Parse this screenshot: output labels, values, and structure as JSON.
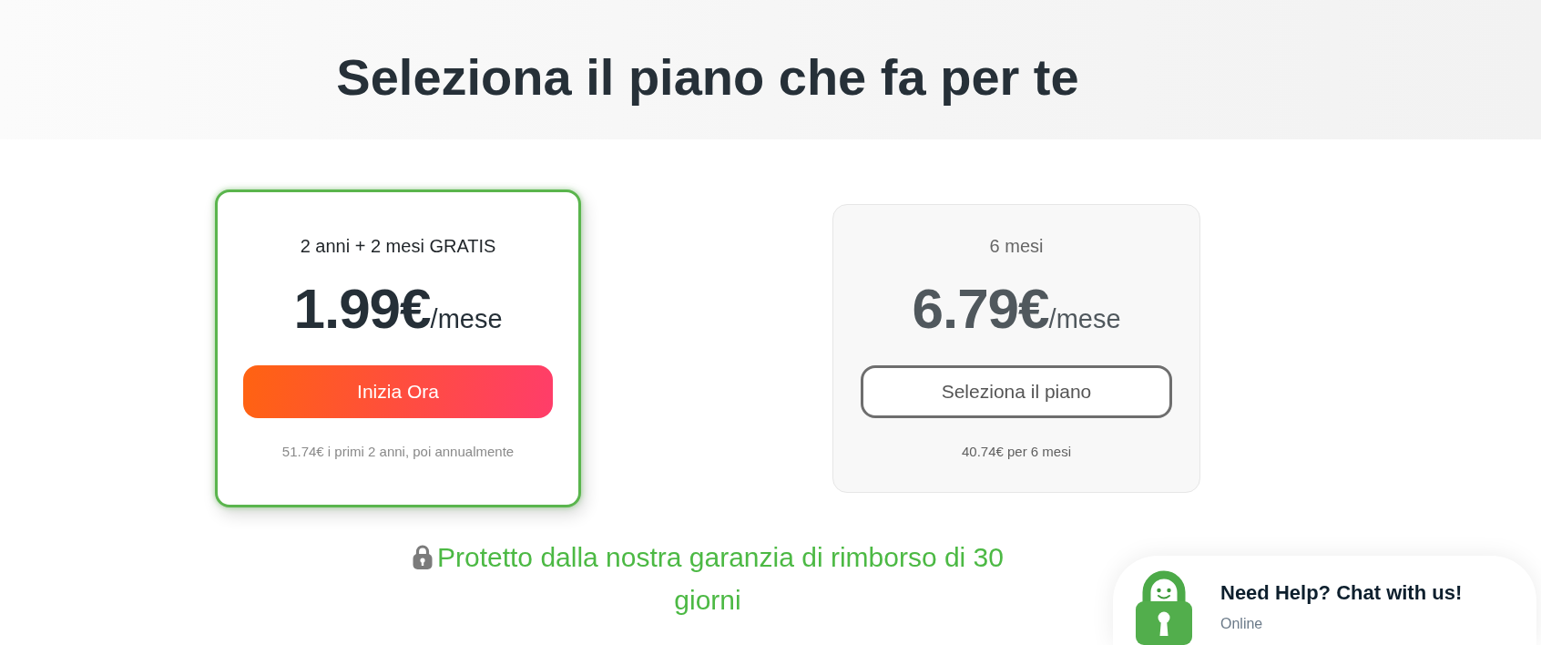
{
  "header": {
    "title": "Seleziona il piano che fa per te"
  },
  "plans": [
    {
      "term": "2 anni + 2 mesi GRATIS",
      "price": "1.99€",
      "period": "/mese",
      "button": "Inizia Ora",
      "note": "51.74€ i primi 2 anni, poi annualmente",
      "selected": true
    },
    {
      "term": "6 mesi",
      "price": "6.79€",
      "period": "/mese",
      "button": "Seleziona il piano",
      "note": "40.74€ per 6 mesi",
      "selected": false
    }
  ],
  "guarantee": {
    "text": "Protetto dalla nostra garanzia di rimborso di 30 giorni"
  },
  "chat_widget": {
    "title": "Need Help? Chat with us!",
    "status": "Online"
  }
}
